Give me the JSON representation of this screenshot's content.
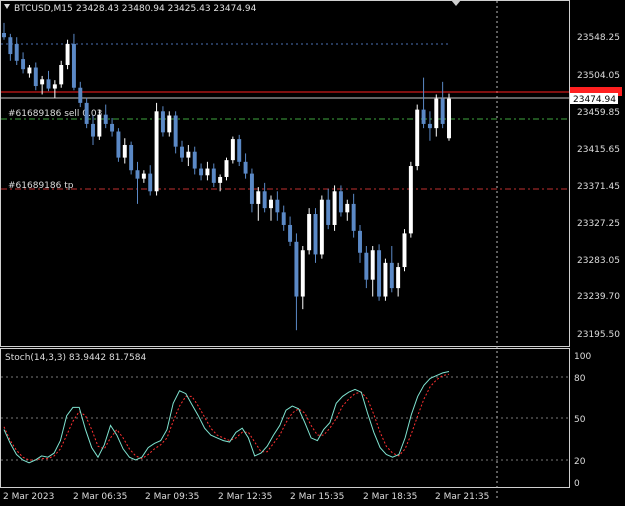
{
  "header": {
    "symbol_tf": "BTCUSD,M15",
    "ohlc": "23428.43 23480.94 23425.43 23474.94"
  },
  "colors": {
    "bg": "#000000",
    "bull": "#ffffff",
    "bear": "#5b89c6",
    "stoch_main": "#7fe3d0",
    "stoch_signal": "#ff3030"
  },
  "price_axis": {
    "labels": [
      "23548.25",
      "23504.05",
      "23459.85",
      "23415.65",
      "23371.45",
      "23327.25",
      "23283.05",
      "23239.70",
      "23195.50"
    ],
    "current_price": "23474.94"
  },
  "order_lines": [
    {
      "label": "#61689186 sell 0.03",
      "price": 23462.5,
      "style": "sell"
    },
    {
      "label": "#61689186 tp",
      "price": 23368.5,
      "style": "tp"
    }
  ],
  "stoch": {
    "label": "Stoch(14,3,3) 83.9442 81.7584",
    "levels": [
      "100",
      "80",
      "50",
      "20",
      "0"
    ]
  },
  "time_axis": {
    "labels": [
      "2 Mar 2023",
      "2 Mar 06:35",
      "2 Mar 09:35",
      "2 Mar 12:35",
      "2 Mar 15:35",
      "2 Mar 18:35",
      "2 Mar 21:35"
    ]
  },
  "chart_data": {
    "type": "candlestick",
    "title": "BTCUSD,M15",
    "ylim": [
      23180,
      23590
    ],
    "candles": [
      [
        23553,
        23565,
        23545,
        23548
      ],
      [
        23548,
        23552,
        23520,
        23528
      ],
      [
        23540,
        23548,
        23515,
        23520
      ],
      [
        23522,
        23530,
        23505,
        23510
      ],
      [
        23505,
        23515,
        23500,
        23512
      ],
      [
        23512,
        23518,
        23485,
        23490
      ],
      [
        23492,
        23502,
        23480,
        23498
      ],
      [
        23498,
        23508,
        23484,
        23487
      ],
      [
        23487,
        23497,
        23476,
        23492
      ],
      [
        23492,
        23520,
        23488,
        23515
      ],
      [
        23515,
        23545,
        23510,
        23540
      ],
      [
        23540,
        23552,
        23485,
        23488
      ],
      [
        23488,
        23495,
        23465,
        23470
      ],
      [
        23470,
        23476,
        23440,
        23445
      ],
      [
        23445,
        23455,
        23420,
        23430
      ],
      [
        23430,
        23462,
        23426,
        23456
      ],
      [
        23456,
        23468,
        23440,
        23445
      ],
      [
        23445,
        23452,
        23430,
        23436
      ],
      [
        23436,
        23440,
        23400,
        23405
      ],
      [
        23405,
        23428,
        23398,
        23420
      ],
      [
        23420,
        23424,
        23385,
        23390
      ],
      [
        23390,
        23400,
        23350,
        23380
      ],
      [
        23380,
        23390,
        23375,
        23386
      ],
      [
        23386,
        23396,
        23360,
        23365
      ],
      [
        23365,
        23470,
        23360,
        23460
      ],
      [
        23460,
        23466,
        23430,
        23435
      ],
      [
        23435,
        23460,
        23430,
        23455
      ],
      [
        23455,
        23460,
        23410,
        23418
      ],
      [
        23418,
        23425,
        23400,
        23405
      ],
      [
        23405,
        23420,
        23395,
        23412
      ],
      [
        23412,
        23418,
        23385,
        23392
      ],
      [
        23392,
        23398,
        23378,
        23384
      ],
      [
        23384,
        23400,
        23378,
        23392
      ],
      [
        23392,
        23398,
        23370,
        23375
      ],
      [
        23375,
        23385,
        23365,
        23382
      ],
      [
        23382,
        23405,
        23378,
        23402
      ],
      [
        23402,
        23430,
        23398,
        23427
      ],
      [
        23427,
        23432,
        23395,
        23400
      ],
      [
        23400,
        23410,
        23380,
        23386
      ],
      [
        23386,
        23392,
        23340,
        23350
      ],
      [
        23350,
        23370,
        23330,
        23365
      ],
      [
        23365,
        23375,
        23340,
        23345
      ],
      [
        23345,
        23360,
        23330,
        23355
      ],
      [
        23355,
        23365,
        23330,
        23340
      ],
      [
        23340,
        23348,
        23318,
        23325
      ],
      [
        23325,
        23335,
        23300,
        23305
      ],
      [
        23305,
        23315,
        23200,
        23240
      ],
      [
        23240,
        23300,
        23225,
        23295
      ],
      [
        23295,
        23345,
        23290,
        23338
      ],
      [
        23338,
        23345,
        23280,
        23290
      ],
      [
        23290,
        23360,
        23285,
        23355
      ],
      [
        23355,
        23368,
        23320,
        23325
      ],
      [
        23325,
        23372,
        23318,
        23365
      ],
      [
        23365,
        23372,
        23335,
        23340
      ],
      [
        23340,
        23355,
        23330,
        23350
      ],
      [
        23350,
        23362,
        23310,
        23318
      ],
      [
        23318,
        23325,
        23280,
        23292
      ],
      [
        23292,
        23300,
        23250,
        23260
      ],
      [
        23260,
        23300,
        23240,
        23295
      ],
      [
        23295,
        23302,
        23235,
        23240
      ],
      [
        23240,
        23285,
        23235,
        23280
      ],
      [
        23280,
        23300,
        23245,
        23250
      ],
      [
        23250,
        23280,
        23240,
        23275
      ],
      [
        23275,
        23320,
        23270,
        23315
      ],
      [
        23315,
        23400,
        23310,
        23395
      ],
      [
        23395,
        23468,
        23390,
        23462
      ],
      [
        23462,
        23500,
        23440,
        23445
      ],
      [
        23445,
        23460,
        23425,
        23440
      ],
      [
        23440,
        23480,
        23430,
        23475
      ],
      [
        23475,
        23495,
        23440,
        23445
      ],
      [
        23428,
        23481,
        23425,
        23475
      ]
    ],
    "stoch_main": [
      42,
      32,
      24,
      20,
      18,
      20,
      23,
      22,
      25,
      34,
      52,
      58,
      58,
      42,
      29,
      22,
      31,
      45,
      38,
      28,
      22,
      20,
      22,
      29,
      32,
      34,
      42,
      61,
      70,
      68,
      60,
      52,
      43,
      38,
      36,
      34,
      33,
      40,
      43,
      36,
      23,
      25,
      30,
      38,
      45,
      56,
      59,
      57,
      47,
      36,
      34,
      42,
      47,
      61,
      66,
      69,
      71,
      69,
      54,
      40,
      29,
      24,
      22,
      24,
      36,
      53,
      66,
      74,
      79,
      81,
      83,
      84
    ],
    "stoch_signal": [
      44,
      34,
      27,
      22,
      20,
      20,
      21,
      21,
      23,
      28,
      38,
      48,
      55,
      52,
      42,
      30,
      28,
      36,
      42,
      36,
      28,
      23,
      21,
      24,
      28,
      31,
      36,
      48,
      59,
      66,
      66,
      59,
      51,
      43,
      38,
      36,
      34,
      36,
      40,
      40,
      33,
      26,
      26,
      32,
      38,
      47,
      54,
      57,
      54,
      45,
      38,
      38,
      43,
      50,
      59,
      64,
      68,
      69,
      64,
      53,
      40,
      30,
      25,
      23,
      28,
      39,
      52,
      64,
      73,
      78,
      81,
      82
    ]
  }
}
